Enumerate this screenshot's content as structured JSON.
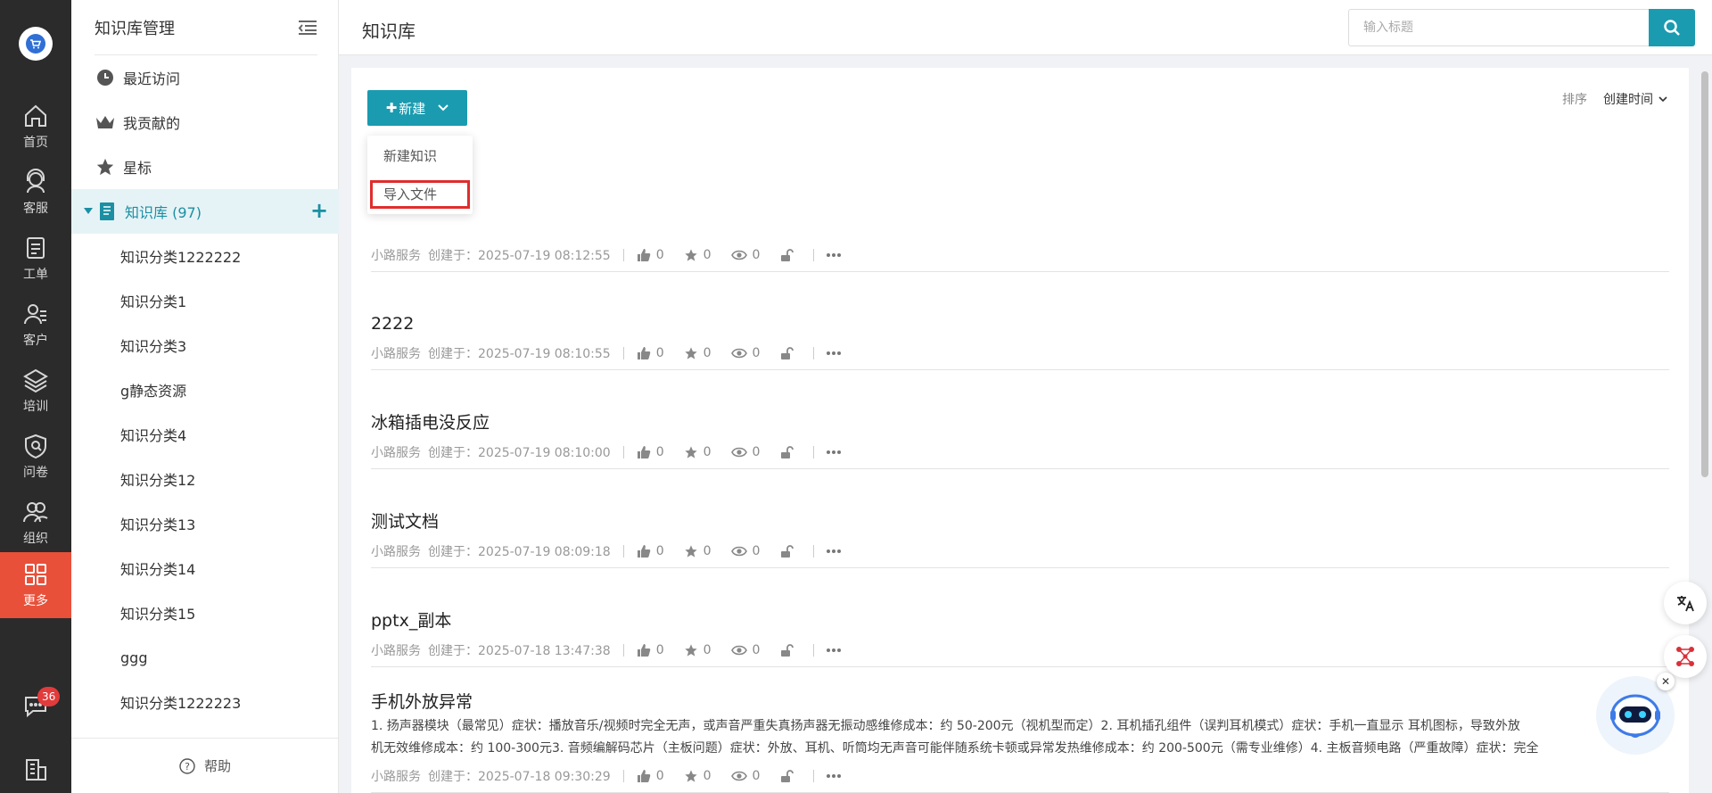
{
  "rail": {
    "items": [
      {
        "label": "首页",
        "icon": "home-icon"
      },
      {
        "label": "客服",
        "icon": "headset-icon"
      },
      {
        "label": "工单",
        "icon": "ticket-icon"
      },
      {
        "label": "客户",
        "icon": "customer-icon"
      },
      {
        "label": "培训",
        "icon": "layers-icon"
      },
      {
        "label": "问卷",
        "icon": "survey-icon"
      },
      {
        "label": "组织",
        "icon": "org-icon"
      },
      {
        "label": "更多",
        "icon": "grid-icon"
      }
    ],
    "badge": "36"
  },
  "sidebar": {
    "title": "知识库管理",
    "nav": [
      {
        "label": "最近访问",
        "icon": "clock-icon"
      },
      {
        "label": "我贡献的",
        "icon": "crown-icon"
      },
      {
        "label": "星标",
        "icon": "star-icon"
      }
    ],
    "kb_label": "知识库 (97)",
    "categories": [
      "知识分类1222222",
      "知识分类1",
      "知识分类3",
      "g静态资源",
      "知识分类4",
      "知识分类12",
      "知识分类13",
      "知识分类14",
      "知识分类15",
      "ggg",
      "知识分类1222223"
    ],
    "help": "帮助"
  },
  "header": {
    "title": "知识库",
    "search_placeholder": "输入标题"
  },
  "toolbar": {
    "new_label": "新建",
    "menu": [
      "新建知识",
      "导入文件"
    ],
    "sort_label": "排序",
    "sort_value": "创建时间"
  },
  "articles": [
    {
      "title": "",
      "author": "小路服务",
      "created": "创建于：2025-07-19 08:12:55",
      "likes": "0",
      "stars": "0",
      "views": "0"
    },
    {
      "title": "2222",
      "author": "小路服务",
      "created": "创建于：2025-07-19 08:10:55",
      "likes": "0",
      "stars": "0",
      "views": "0"
    },
    {
      "title": "冰箱插电没反应",
      "author": "小路服务",
      "created": "创建于：2025-07-19 08:10:00",
      "likes": "0",
      "stars": "0",
      "views": "0"
    },
    {
      "title": "测试文档",
      "author": "小路服务",
      "created": "创建于：2025-07-19 08:09:18",
      "likes": "0",
      "stars": "0",
      "views": "0"
    },
    {
      "title": "pptx_副本",
      "author": "小路服务",
      "created": "创建于：2025-07-18 13:47:38",
      "likes": "0",
      "stars": "0",
      "views": "0"
    },
    {
      "title": "手机外放异常",
      "body1": "1. 扬声器模块（最常见）症状：播放音乐/视频时完全无声，或声音严重失真扬声器无振动感维修成本：约 50-200元（视机型而定）2. 耳机插孔组件（误判耳机模式）症状：手机一直显示 耳机图标，导致外放",
      "body2": "机无效维修成本：约 100-300元3. 音频编解码芯片（主板问题）症状：外放、耳机、听筒均无声音可能伴随系统卡顿或异常发热维修成本：约 200-500元（需专业维修）4. 主板音频电路（严重故障）症状：完全",
      "author": "小路服务",
      "created": "创建于：2025-07-18 09:30:29",
      "likes": "0",
      "stars": "0",
      "views": "0"
    }
  ],
  "colors": {
    "accent": "#1a9bb0",
    "rail_bg": "#2b2b2b",
    "rail_active": "#e8503a",
    "highlight": "#e02d2d"
  }
}
